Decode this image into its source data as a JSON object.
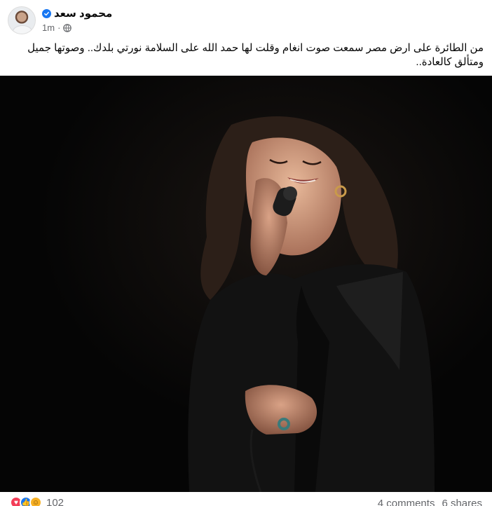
{
  "post": {
    "author": "محمود سعد",
    "verified": true,
    "time": "1m",
    "privacy_icon": "globe-icon",
    "caption": "من الطائرة على ارض مصر سمعت صوت انغام وقلت لها حمد الله على السلامة نورتي بلدك.. وصوتها جميل ومتألق كالعادة..",
    "image_alt": "Singer performing with microphone on dark stage"
  },
  "engagement": {
    "reaction_icons": [
      "love-icon",
      "like-icon",
      "care-icon"
    ],
    "reaction_count": "102",
    "comments": "4 comments",
    "shares": "6 shares"
  },
  "colors": {
    "verified_blue": "#1877f2",
    "meta_gray": "#65676b",
    "text": "#050505",
    "photo_bg": "#050505"
  }
}
